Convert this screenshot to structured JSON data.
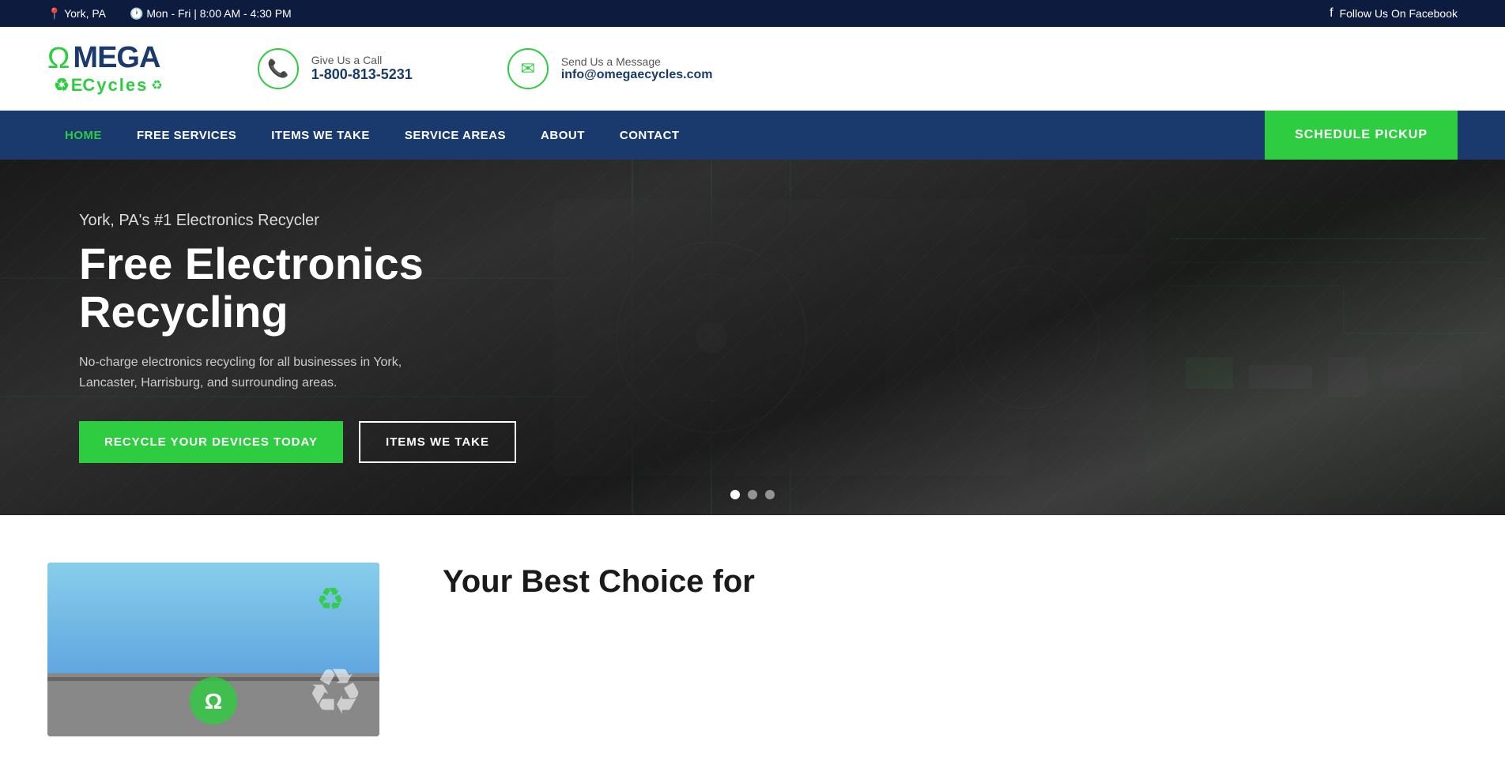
{
  "topbar": {
    "location": "York, PA",
    "hours": "Mon - Fri | 8:00 AM - 4:30 PM",
    "social": "Follow Us On Facebook"
  },
  "header": {
    "logo_brand": "MEGA",
    "logo_omega": "Ω",
    "logo_ecycles": "ECycles",
    "phone_label": "Give Us a Call",
    "phone_number": "1-800-813-5231",
    "email_label": "Send Us a Message",
    "email_value": "info@omegaecycles.com"
  },
  "nav": {
    "items": [
      {
        "label": "HOME",
        "active": true
      },
      {
        "label": "FREE SERVICES",
        "active": false
      },
      {
        "label": "ITEMS WE TAKE",
        "active": false
      },
      {
        "label": "SERVICE AREAS",
        "active": false
      },
      {
        "label": "ABOUT",
        "active": false
      },
      {
        "label": "CONTACT",
        "active": false
      }
    ],
    "cta_label": "SCHEDULE PICKUP"
  },
  "hero": {
    "subtitle": "York, PA's #1 Electronics Recycler",
    "title_line1": "Free Electronics",
    "title_line2": "Recycling",
    "description": "No-charge electronics recycling for all businesses in York, Lancaster, Harrisburg, and surrounding areas.",
    "btn_primary": "RECYCLE YOUR DEVICES TODAY",
    "btn_secondary": "ITEMS WE TAKE",
    "dots": [
      {
        "active": true
      },
      {
        "active": false
      },
      {
        "active": false
      }
    ]
  },
  "below_hero": {
    "title_line1": "Your Best Choice for"
  }
}
